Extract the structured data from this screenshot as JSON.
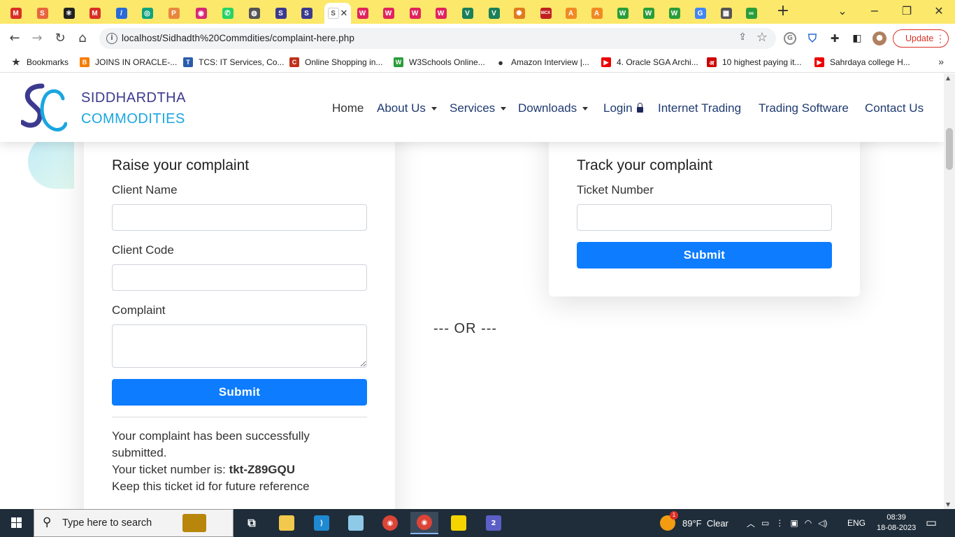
{
  "browser": {
    "tabs": [
      {
        "icon": "gmail-icon",
        "glyph": "M",
        "color": "#d93025"
      },
      {
        "icon": "s-icon",
        "glyph": "S",
        "color": "#e8663d"
      },
      {
        "icon": "react-icon",
        "glyph": "⚛",
        "color": "#222"
      },
      {
        "icon": "gmail-icon",
        "glyph": "M",
        "color": "#d93025"
      },
      {
        "icon": "feather-icon",
        "glyph": "/",
        "color": "#2a6ad8"
      },
      {
        "icon": "openai-icon",
        "glyph": "◎",
        "color": "#10a37f"
      },
      {
        "icon": "pma-icon",
        "glyph": "P",
        "color": "#e8883d"
      },
      {
        "icon": "instagram-icon",
        "glyph": "◉",
        "color": "#d62976"
      },
      {
        "icon": "whatsapp-icon",
        "glyph": "✆",
        "color": "#25d366"
      },
      {
        "icon": "chrome-icon",
        "glyph": "◍",
        "color": "#555"
      },
      {
        "icon": "site-s-icon",
        "glyph": "S",
        "color": "#3c3a8e"
      },
      {
        "icon": "site-s-icon",
        "glyph": "S",
        "color": "#3c3a8e"
      },
      {
        "icon": "site-s-icon",
        "glyph": "S",
        "color": "#3c3a8e",
        "active": true
      },
      {
        "icon": "w-icon",
        "glyph": "W",
        "color": "#e0245e"
      },
      {
        "icon": "w-icon",
        "glyph": "W",
        "color": "#e0245e"
      },
      {
        "icon": "w-icon",
        "glyph": "W",
        "color": "#e0245e"
      },
      {
        "icon": "w-icon",
        "glyph": "W",
        "color": "#e0245e"
      },
      {
        "icon": "v-icon",
        "glyph": "V",
        "color": "#1a7f5a"
      },
      {
        "icon": "v-icon",
        "glyph": "V",
        "color": "#1a7f5a"
      },
      {
        "icon": "sun-icon",
        "glyph": "✺",
        "color": "#e07a1f"
      },
      {
        "icon": "mcx-icon",
        "glyph": "MCX",
        "color": "#c02020"
      },
      {
        "icon": "orange-a-icon",
        "glyph": "A",
        "color": "#f08a24"
      },
      {
        "icon": "orange-a-icon",
        "glyph": "A",
        "color": "#f08a24"
      },
      {
        "icon": "w-green-icon",
        "glyph": "W",
        "color": "#2a9d3a"
      },
      {
        "icon": "w-green-icon",
        "glyph": "W",
        "color": "#2a9d3a"
      },
      {
        "icon": "w-green-icon",
        "glyph": "W",
        "color": "#2a9d3a"
      },
      {
        "icon": "google-icon",
        "glyph": "G",
        "color": "#4285f4"
      },
      {
        "icon": "table-icon",
        "glyph": "▦",
        "color": "#555"
      },
      {
        "icon": "infinity-icon",
        "glyph": "∞",
        "color": "#2a9d3a"
      }
    ],
    "url": "localhost/Sidhadth%20Commdities/complaint-here.php",
    "update_label": "Update",
    "bookmarks": [
      {
        "label": "Bookmarks",
        "icon": "star-icon",
        "color": "#333",
        "glyph": "★"
      },
      {
        "label": "JOINS IN ORACLE-...",
        "icon": "blogger-icon",
        "color": "#f57d00",
        "glyph": "B"
      },
      {
        "label": "TCS: IT Services, Co...",
        "icon": "tata-icon",
        "color": "#2a5caa",
        "glyph": "T"
      },
      {
        "label": "Online Shopping in...",
        "icon": "ebay-c-icon",
        "color": "#c0301a",
        "glyph": "C"
      },
      {
        "label": "W3Schools Online...",
        "icon": "w3-icon",
        "color": "#2a9d3a",
        "glyph": "W"
      },
      {
        "label": "Amazon Interview |...",
        "icon": "globe-icon",
        "color": "#333",
        "glyph": "●"
      },
      {
        "label": "4. Oracle SGA Archi...",
        "icon": "youtube-icon",
        "color": "#e00",
        "glyph": "▶"
      },
      {
        "label": "10 highest paying it...",
        "icon": "news-icon",
        "color": "#c00",
        "glyph": "अ"
      },
      {
        "label": "Sahrdaya college H...",
        "icon": "youtube-icon",
        "color": "#e00",
        "glyph": "▶"
      }
    ]
  },
  "site": {
    "brand_line1": "SIDDHARDTHA",
    "brand_line2": "COMMODITIES",
    "nav": [
      {
        "label": "Home",
        "caret": false
      },
      {
        "label": "About Us",
        "caret": true
      },
      {
        "label": "Services",
        "caret": true
      },
      {
        "label": "Downloads",
        "caret": true
      },
      {
        "label": "Login",
        "caret": false,
        "lock": true
      },
      {
        "label": "Internet Trading",
        "caret": false
      },
      {
        "label": "Trading Software",
        "caret": false
      },
      {
        "label": "Contact Us",
        "caret": false
      }
    ],
    "raise": {
      "title": "Raise your complaint",
      "client_name_label": "Client Name",
      "client_name_value": "",
      "client_code_label": "Client Code",
      "client_code_value": "",
      "complaint_label": "Complaint",
      "complaint_value": "",
      "submit_label": "Submit",
      "success_line1": "Your complaint has been successfully",
      "success_line2": "submitted.",
      "ticket_prefix": "Your ticket number is: ",
      "ticket_number": "tkt-Z89GQU",
      "success_line4": "Keep this ticket id for future reference"
    },
    "or_text": "--- OR ---",
    "track": {
      "title": "Track your complaint",
      "ticket_label": "Ticket Number",
      "ticket_value": "",
      "submit_label": "Submit"
    },
    "colors": {
      "brand_navy": "#3c3a8e",
      "brand_cyan": "#1aa6e0",
      "button_blue": "#0d7cff",
      "nav_text": "#1f3a70"
    }
  },
  "taskbar": {
    "search_placeholder": "Type here to search",
    "weather": "89°F  Clear",
    "language": "ENG",
    "time": "08:39",
    "date": "18-08-2023",
    "weather_badge": "1",
    "teams_badge": "2"
  }
}
